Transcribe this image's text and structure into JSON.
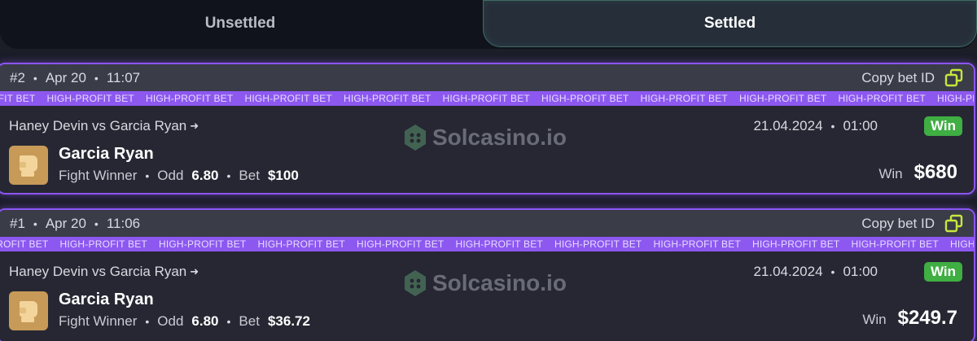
{
  "tabs": {
    "unsettled": "Unsettled",
    "settled": "Settled"
  },
  "ribbon_text": "HIGH-PROFIT BET",
  "watermark": "Solcasino.io",
  "bets": [
    {
      "id": "#2",
      "date": "Apr 20",
      "time": "11:07",
      "copy_label": "Copy bet ID",
      "match": "Haney Devin vs Garcia Ryan",
      "event_date": "21.04.2024",
      "event_time": "01:00",
      "status": "Win",
      "pick": "Garcia Ryan",
      "market": "Fight Winner",
      "odd_label": "Odd",
      "odd": "6.80",
      "bet_label": "Bet",
      "bet": "$100",
      "win_label": "Win",
      "win": "$680"
    },
    {
      "id": "#1",
      "date": "Apr 20",
      "time": "11:06",
      "copy_label": "Copy bet ID",
      "match": "Haney Devin vs Garcia Ryan",
      "event_date": "21.04.2024",
      "event_time": "01:00",
      "status": "Win",
      "pick": "Garcia Ryan",
      "market": "Fight Winner",
      "odd_label": "Odd",
      "odd": "6.80",
      "bet_label": "Bet",
      "bet": "$36.72",
      "win_label": "Win",
      "win": "$249.7"
    }
  ],
  "colors": {
    "accent_purple": "#8b55f2",
    "win_green": "#3fae43",
    "copy_icon": "#c8e63c",
    "glove_bg": "#c79a58"
  },
  "icons": {
    "copy": "copy-icon",
    "arrow": "arrow-right-icon",
    "glove": "boxing-glove-icon",
    "logo": "solcasino-logo-icon"
  }
}
